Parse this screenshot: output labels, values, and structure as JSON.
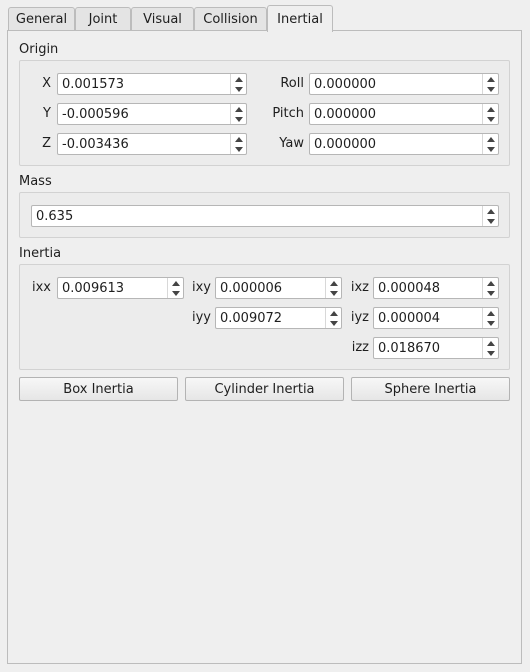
{
  "tabs": [
    {
      "label": "General"
    },
    {
      "label": "Joint"
    },
    {
      "label": "Visual"
    },
    {
      "label": "Collision"
    },
    {
      "label": "Inertial"
    }
  ],
  "active_tab": "Inertial",
  "origin": {
    "title": "Origin",
    "x": {
      "label": "X",
      "value": "0.001573"
    },
    "y": {
      "label": "Y",
      "value": "-0.000596"
    },
    "z": {
      "label": "Z",
      "value": "-0.003436"
    },
    "roll": {
      "label": "Roll",
      "value": "0.000000"
    },
    "pitch": {
      "label": "Pitch",
      "value": "0.000000"
    },
    "yaw": {
      "label": "Yaw",
      "value": "0.000000"
    }
  },
  "mass": {
    "title": "Mass",
    "value": "0.635"
  },
  "inertia": {
    "title": "Inertia",
    "ixx": {
      "label": "ixx",
      "value": "0.009613"
    },
    "ixy": {
      "label": "ixy",
      "value": "0.000006"
    },
    "ixz": {
      "label": "ixz",
      "value": "0.000048"
    },
    "iyy": {
      "label": "iyy",
      "value": "0.009072"
    },
    "iyz": {
      "label": "iyz",
      "value": "0.000004"
    },
    "izz": {
      "label": "izz",
      "value": "0.018670"
    }
  },
  "buttons": {
    "box": "Box Inertia",
    "cylinder": "Cylinder Inertia",
    "sphere": "Sphere Inertia"
  }
}
